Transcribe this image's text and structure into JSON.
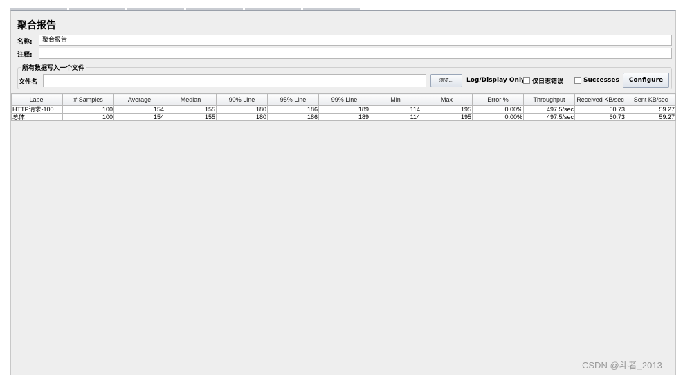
{
  "panel": {
    "title": "聚合报告",
    "name_label": "名称:",
    "name_value": "聚合报告",
    "comment_label": "注释:",
    "comment_value": ""
  },
  "file_group": {
    "title": "所有数据写入一个文件",
    "file_label": "文件名",
    "file_value": "",
    "browse_label": "浏览...",
    "log_display_label": "Log/Display Only:",
    "errors_only_label": "仅日志错误",
    "errors_only_checked": false,
    "successes_label": "Successes",
    "successes_checked": false,
    "configure_label": "Configure"
  },
  "table": {
    "headers": [
      "Label",
      "# Samples",
      "Average",
      "Median",
      "90% Line",
      "95% Line",
      "99% Line",
      "Min",
      "Max",
      "Error %",
      "Throughput",
      "Received KB/sec",
      "Sent KB/sec"
    ],
    "rows": [
      [
        "HTTP请求-100...",
        "100",
        "154",
        "155",
        "180",
        "186",
        "189",
        "114",
        "195",
        "0.00%",
        "497.5/sec",
        "60.73",
        "59.27"
      ],
      [
        "总体",
        "100",
        "154",
        "155",
        "180",
        "186",
        "189",
        "114",
        "195",
        "0.00%",
        "497.5/sec",
        "60.73",
        "59.27"
      ]
    ]
  },
  "watermark": "CSDN @斗者_2013"
}
